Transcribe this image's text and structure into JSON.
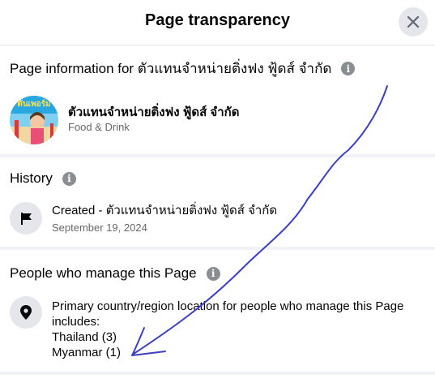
{
  "dialog": {
    "title": "Page transparency",
    "close_icon": "close-icon"
  },
  "page_info": {
    "heading": "Page information for ตัวแทนจำหน่ายติ่งฟง ฟู้ดส์ จำกัด",
    "page_name": "ตัวแทนจำหน่ายติ่งฟง ฟู้ดส์ จำกัด",
    "category": "Food & Drink",
    "avatar_text": "ตันเพอร์ม"
  },
  "history": {
    "heading": "History",
    "created_label": "Created - ตัวแทนจำหน่ายติ่งฟง ฟู้ดส์ จำกัด",
    "created_date": "September 19, 2024",
    "icon": "flag-icon"
  },
  "managers": {
    "heading": "People who manage this Page",
    "description": "Primary country/region location for people who manage this Page includes:",
    "countries": [
      "Thailand (3)",
      "Myanmar (1)"
    ],
    "icon": "location-pin-icon"
  },
  "colors": {
    "info_icon": "#8a8d91",
    "annotation": "#3b3fc4",
    "divider": "#f0f2f5"
  }
}
